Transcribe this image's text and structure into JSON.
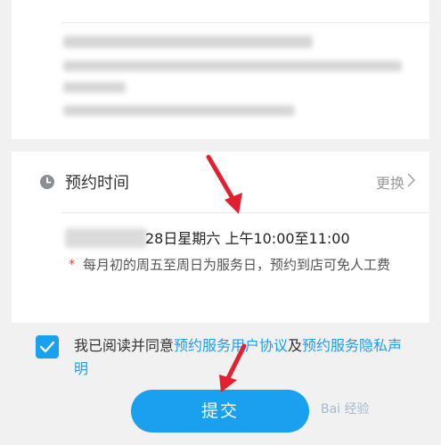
{
  "appointment": {
    "section_title": "预约时间",
    "change_label": "更换",
    "date_text": "28日星期六 上午10:00至11:00",
    "note_marker": "*",
    "note_text": "每月初的周五至周日为服务日，预约到店可免人工费"
  },
  "agreement": {
    "checked": true,
    "prefix": "我已阅读并同意",
    "link_user_agreement": "预约服务用户协议",
    "conjunction": "及",
    "link_privacy": "预约服务隐私声明"
  },
  "submit_label": "提交",
  "watermark_text": "Bai 经验",
  "colors": {
    "accent": "#19a0ef",
    "arrow": "#e3202f",
    "note_marker": "#e94a3c"
  }
}
